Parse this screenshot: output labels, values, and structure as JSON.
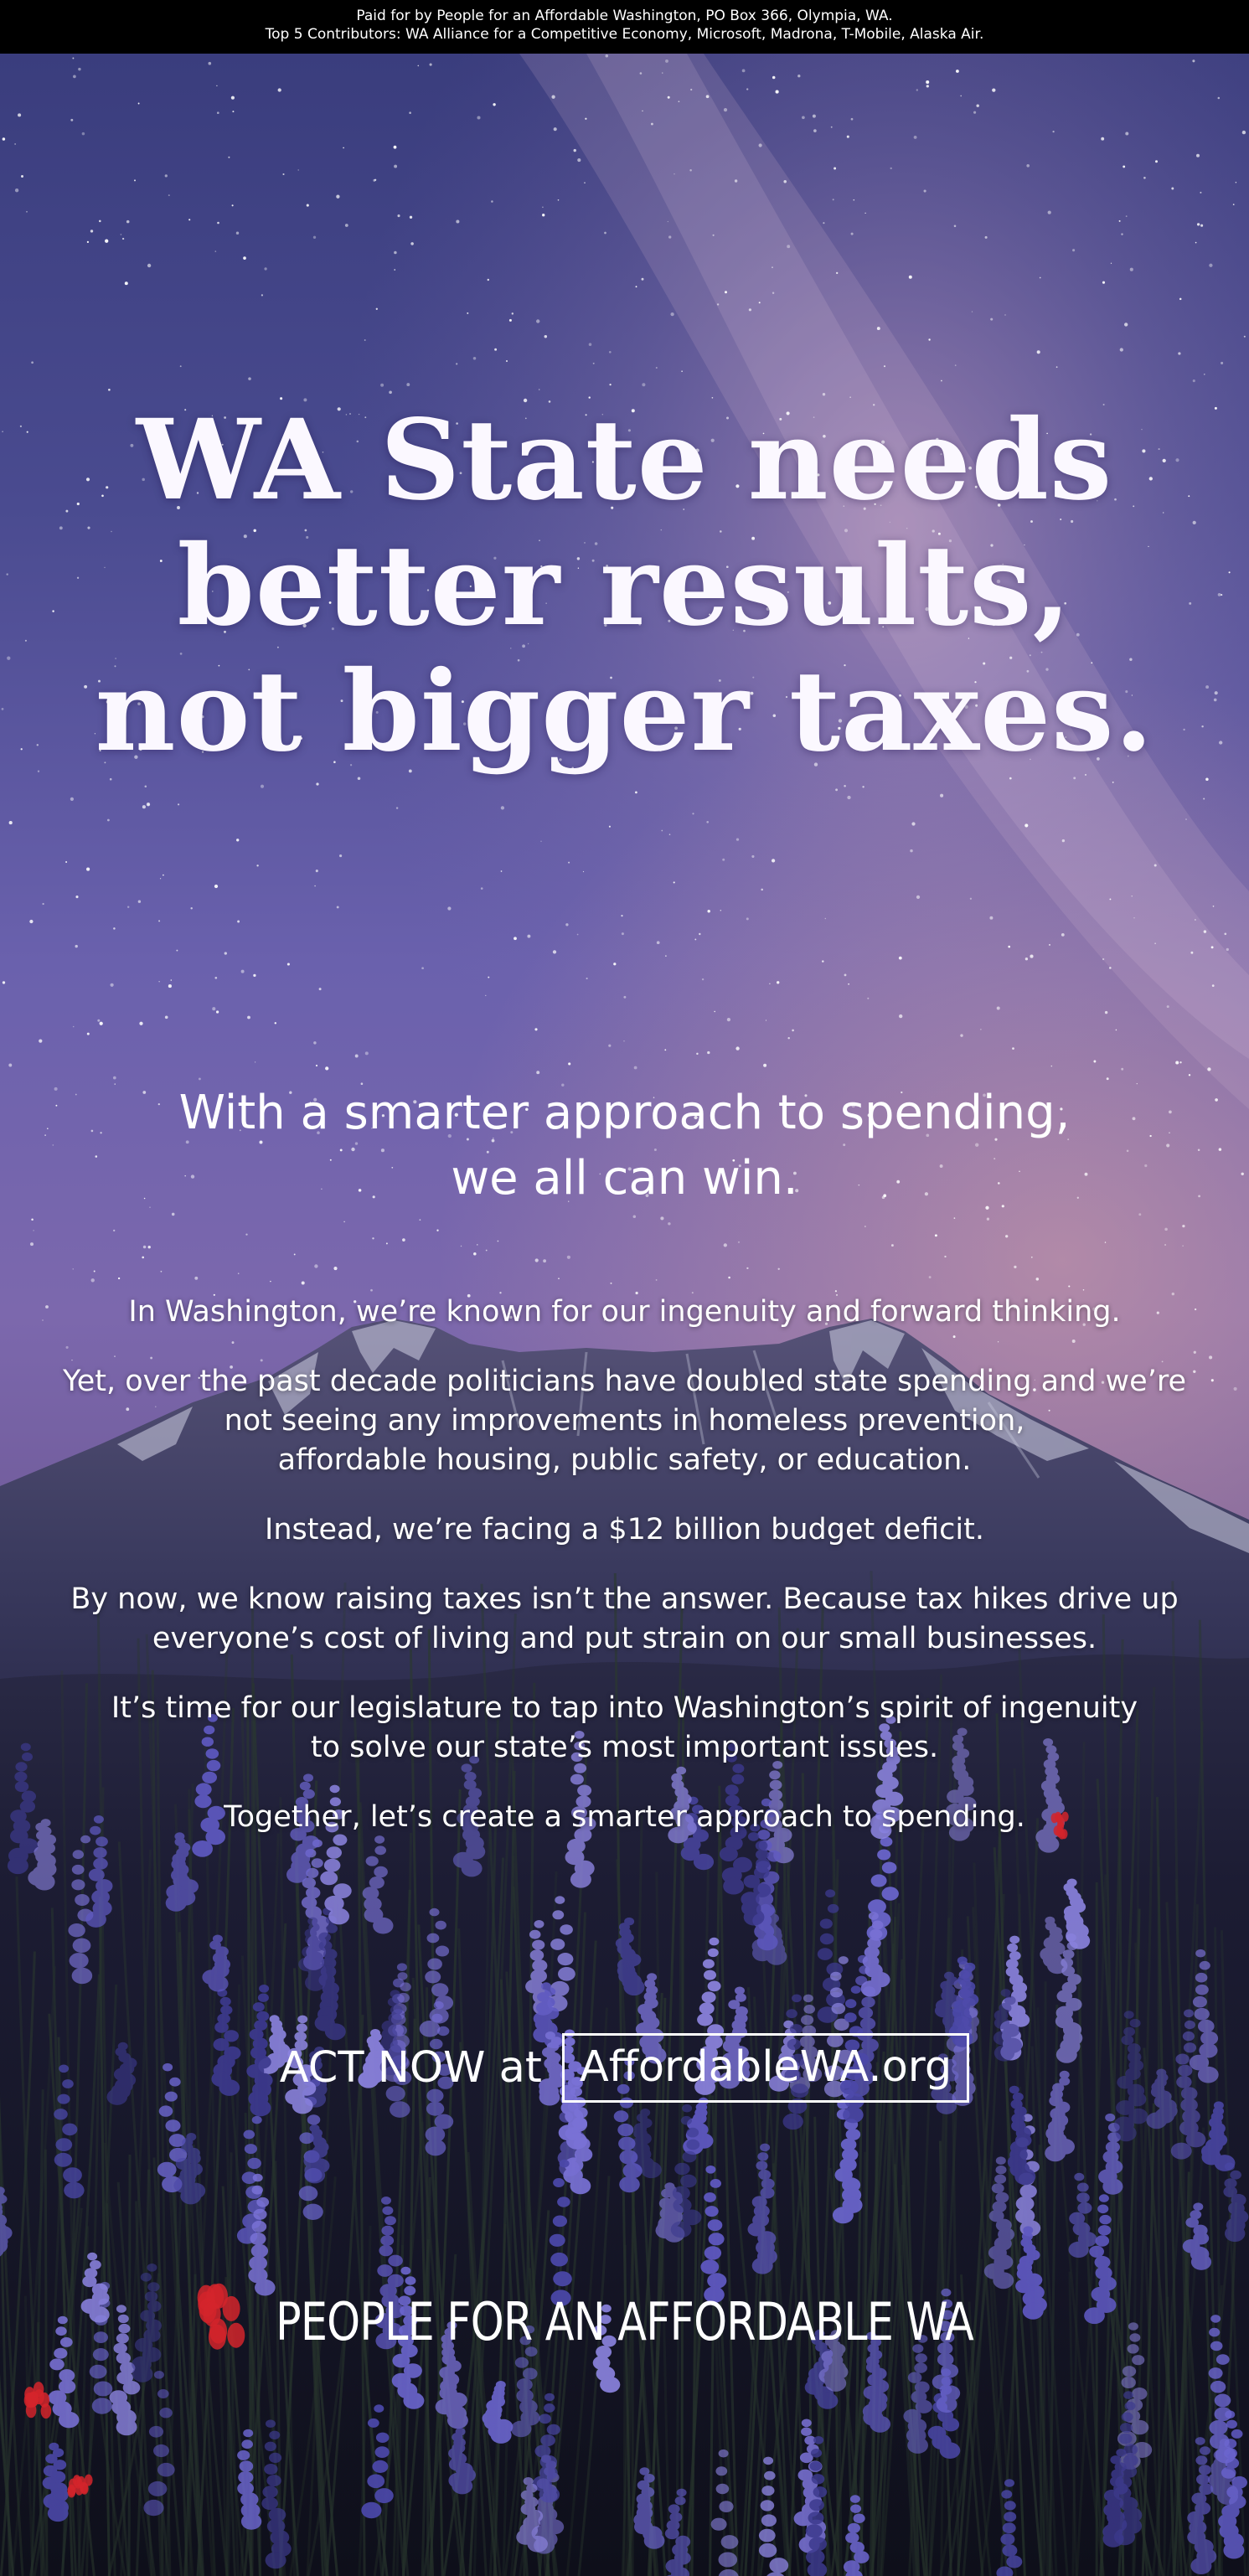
{
  "disclaimer": {
    "line1": "Paid for by People for an Affordable Washington, PO Box 366, Olympia, WA.",
    "line2": "Top 5 Contributors: WA Alliance for a Competitive Economy, Microsoft, Madrona, T-Mobile, Alaska Air."
  },
  "headline": {
    "line1": "WA State needs",
    "line2": "better results,",
    "line3": "not bigger taxes."
  },
  "subhead": {
    "line1": "With a smarter approach to spending,",
    "line2": "we all can win."
  },
  "body": {
    "p1": "In Washington, we’re known for our ingenuity and forward thinking.",
    "p2_line1": "Yet, over the past decade politicians have doubled state spending and we’re",
    "p2_line2": "not seeing any improvements in homeless prevention,",
    "p2_line3": "affordable housing, public safety, or education.",
    "p3": "Instead, we’re facing a $12 billion budget deficit.",
    "p4_line1": "By now, we know raising taxes isn’t the answer. Because tax hikes drive up",
    "p4_line2": "everyone’s cost of living and put strain on our small businesses.",
    "p5_line1": "It’s time for our legislature to tap into Washington’s spirit of ingenuity",
    "p5_line2": "to solve our state’s most important issues.",
    "p6": "Together, let’s create a smarter approach to spending."
  },
  "cta": {
    "label": "ACT NOW at",
    "link": "AffordableWA.org"
  },
  "footer": {
    "name": "PEOPLE FOR AN AFFORDABLE WA"
  },
  "colors": {
    "sky_top": "#3b3d7c",
    "sky_mid": "#6a5fae",
    "sky_glow": "#b089b7",
    "mountain": "#3e3d66",
    "meadow": "#141424",
    "lupine": "#5a55b8",
    "paintbrush": "#d3242c"
  }
}
